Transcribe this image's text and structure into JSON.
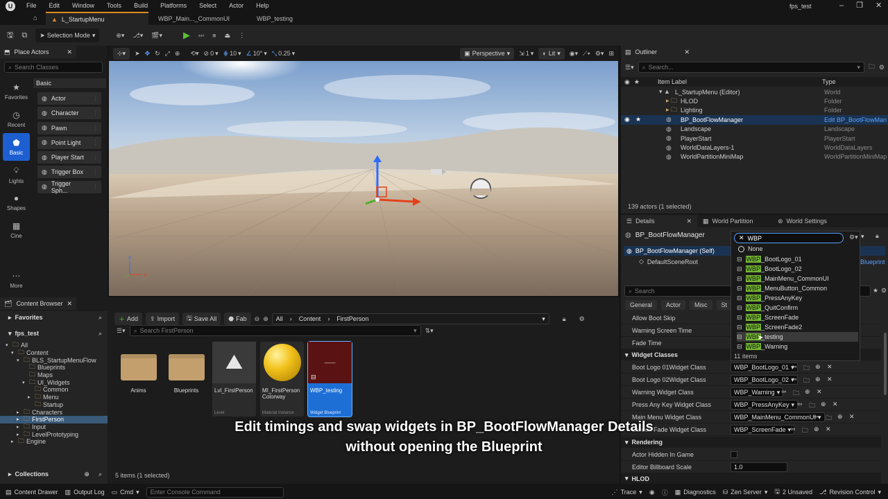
{
  "menubar": {
    "items": [
      "File",
      "Edit",
      "Window",
      "Tools",
      "Build",
      "Platforms",
      "Select",
      "Actor",
      "Help"
    ],
    "project": "fps_test"
  },
  "tabs": [
    {
      "label": "L_StartupMenu"
    },
    {
      "label": "WBP_Main..._CommonUI"
    },
    {
      "label": "WBP_testing"
    }
  ],
  "toolbar": {
    "mode": "Selection Mode"
  },
  "viewport": {
    "perspective": "Perspective",
    "lit": "Lit",
    "snap_move": "10",
    "snap_rot": "10°",
    "snap_scale": "0.25",
    "fov_count": "1",
    "zero": "0"
  },
  "place_actors": {
    "title": "Place Actors",
    "search_placeholder": "Search Classes",
    "category": "Basic",
    "sidebar": [
      {
        "label": "Favorites",
        "icon": "star-icon"
      },
      {
        "label": "Recent",
        "icon": "clock-icon"
      },
      {
        "label": "Basic",
        "icon": "shapes-icon"
      },
      {
        "label": "Lights",
        "icon": "bulb-icon"
      },
      {
        "label": "Shapes",
        "icon": "sphere-icon"
      },
      {
        "label": "Cine",
        "icon": "film-icon"
      },
      {
        "label": "More",
        "icon": "dots-icon"
      }
    ],
    "items": [
      "Actor",
      "Character",
      "Pawn",
      "Point Light",
      "Player Start",
      "Trigger Box",
      "Trigger Sph..."
    ]
  },
  "outliner": {
    "title": "Outliner",
    "search_placeholder": "Search...",
    "col_label": "Item Label",
    "col_type": "Type",
    "rows": [
      {
        "label": "L_StartupMenu (Editor)",
        "type": "World",
        "indent": 0
      },
      {
        "label": "HLOD",
        "type": "Folder",
        "indent": 1
      },
      {
        "label": "Lighting",
        "type": "Folder",
        "indent": 1
      },
      {
        "label": "BP_BootFlowManager",
        "type": "Edit BP_BootFlowManager",
        "indent": 1
      },
      {
        "label": "Landscape",
        "type": "Landscape",
        "indent": 1
      },
      {
        "label": "PlayerStart",
        "type": "PlayerStart",
        "indent": 1
      },
      {
        "label": "WorldDataLayers-1",
        "type": "WorldDataLayers",
        "indent": 1
      },
      {
        "label": "WorldPartitionMiniMap",
        "type": "WorldPartitionMiniMap",
        "indent": 1
      }
    ],
    "status": "139 actors (1 selected)"
  },
  "details": {
    "tabs": [
      "Details",
      "World Partition",
      "World Settings"
    ],
    "actor_name": "BP_BootFlowManager",
    "component_self": "BP_BootFlowManager (Self)",
    "component_root": "DefaultSceneRoot",
    "blueprint_link": "Blueprint",
    "search_placeholder": "Search",
    "filters": [
      "General",
      "Actor",
      "Misc",
      "St"
    ],
    "rows_top": [
      {
        "label": "Allow Boot Skip"
      },
      {
        "label": "Warning Screen Time"
      },
      {
        "label": "Fade Time"
      }
    ],
    "section_widget": "Widget Classes",
    "widget_rows": [
      {
        "label": "Boot Logo 01Widget Class",
        "value": "WBP_BootLogo_01"
      },
      {
        "label": "Boot Logo 02Widget Class",
        "value": "WBP_BootLogo_02"
      },
      {
        "label": "Warning Widget Class",
        "value": "WBP_Warning"
      },
      {
        "label": "Press Any Key Widget Class",
        "value": "WBP_PressAnyKey"
      },
      {
        "label": "Main Menu Widget Class",
        "value": "WBP_MainMenu_CommonUI"
      },
      {
        "label": "Screen Fade Widget Class",
        "value": "WBP_ScreenFade"
      }
    ],
    "section_render": "Rendering",
    "render_rows": [
      {
        "label": "Actor Hidden In Game",
        "value": ""
      },
      {
        "label": "Editor Billboard Scale",
        "value": "1.0"
      }
    ],
    "section_hlod": "HLOD"
  },
  "dropdown": {
    "search_value": "WBP",
    "none": "None",
    "items": [
      {
        "pre": "WBP",
        "post": "_BootLogo_01"
      },
      {
        "pre": "WBP",
        "post": "_BootLogo_02"
      },
      {
        "pre": "WBP",
        "post": "_MainMenu_CommonUI"
      },
      {
        "pre": "WBP",
        "post": "_MenuButton_Common"
      },
      {
        "pre": "WBP",
        "post": "_PressAnyKey"
      },
      {
        "pre": "WBP",
        "post": "_QuitConfirm"
      },
      {
        "pre": "WBP",
        "post": "_ScreenFade"
      },
      {
        "pre": "WBP",
        "post": "_ScreenFade2"
      },
      {
        "pre": "WBP",
        "post": "_testing"
      },
      {
        "pre": "WBP",
        "post": "_Warning"
      }
    ],
    "count": "11 items"
  },
  "content_browser": {
    "title": "Content Browser",
    "favorites": "Favorites",
    "project": "fps_test",
    "collections": "Collections",
    "add": "Add",
    "import": "Import",
    "save_all": "Save All",
    "fab": "Fab",
    "path": [
      "All",
      "Content",
      "FirstPerson"
    ],
    "search_placeholder": "Search FirstPerson",
    "tree": [
      {
        "label": "All",
        "indent": 0
      },
      {
        "label": "Content",
        "indent": 1
      },
      {
        "label": "BLS_StartupMenuFlow",
        "indent": 2
      },
      {
        "label": "Blueprints",
        "indent": 3
      },
      {
        "label": "Maps",
        "indent": 3
      },
      {
        "label": "UI_Widgets",
        "indent": 3
      },
      {
        "label": "Common",
        "indent": 4
      },
      {
        "label": "Menu",
        "indent": 4
      },
      {
        "label": "Startup",
        "indent": 4
      },
      {
        "label": "Characters",
        "indent": 2
      },
      {
        "label": "FirstPerson",
        "indent": 2
      },
      {
        "label": "Input",
        "indent": 2
      },
      {
        "label": "LevelPrototyping",
        "indent": 2
      },
      {
        "label": "Engine",
        "indent": 1
      }
    ],
    "assets": [
      {
        "name": "Anims",
        "type": "",
        "kind": "folder"
      },
      {
        "name": "Blueprints",
        "type": "",
        "kind": "folder"
      },
      {
        "name": "Lvl_FirstPerson",
        "type": "Level",
        "kind": "level"
      },
      {
        "name": "MI_FirstPerson Colorway",
        "type": "Material Instance",
        "kind": "material"
      },
      {
        "name": "WBP_testing",
        "type": "Widget Blueprint",
        "kind": "widget"
      }
    ],
    "status": "5 items (1 selected)"
  },
  "caption": {
    "line1": "Edit timings and swap widgets in BP_BootFlowManager Details",
    "line2": "without opening the Blueprint"
  },
  "statusbar": {
    "content_drawer": "Content Drawer",
    "output_log": "Output Log",
    "cmd": "Cmd",
    "console_placeholder": "Enter Console Command",
    "trace": "Trace",
    "diagnostics": "Diagnostics",
    "zen": "Zen Server",
    "unsaved": "2 Unsaved",
    "revision": "Revision Control"
  }
}
